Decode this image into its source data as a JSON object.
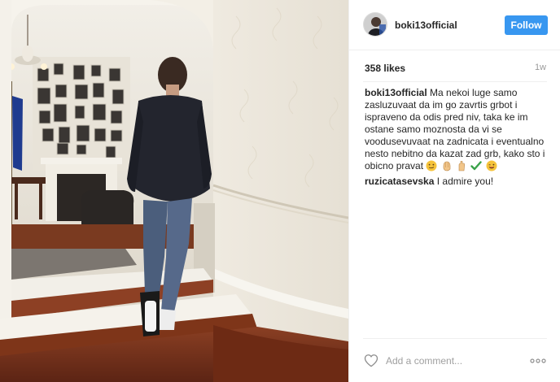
{
  "post": {
    "username": "boki13official",
    "follow_label": "Follow",
    "likes": "358 likes",
    "time_ago": "1w"
  },
  "comments": [
    {
      "author": "boki13official",
      "text": "Ma nekoi luge samo zasluzuvaat da im go zavrtis grbot i ispraveno da odis pred niv, taka ke im ostane samo moznosta da vi se voodusevuvaat na zadnicata i eventualno nesto nebitno da kazat zad grb, kako sto i obicno pravat",
      "emojis": [
        "smirk-face-emoji",
        "clapping-hands-emoji",
        "ok-hand-emoji",
        "check-mark-emoji",
        "winking-face-emoji"
      ]
    },
    {
      "author": "ruzicatasevska",
      "text": "I admire you!"
    }
  ],
  "add_comment": {
    "placeholder": "Add a comment..."
  },
  "icons": {
    "like": "heart-icon",
    "more": "more-options-icon"
  },
  "colors": {
    "follow_button": "#3897f0",
    "border": "#efefef",
    "muted_text": "#999999"
  }
}
